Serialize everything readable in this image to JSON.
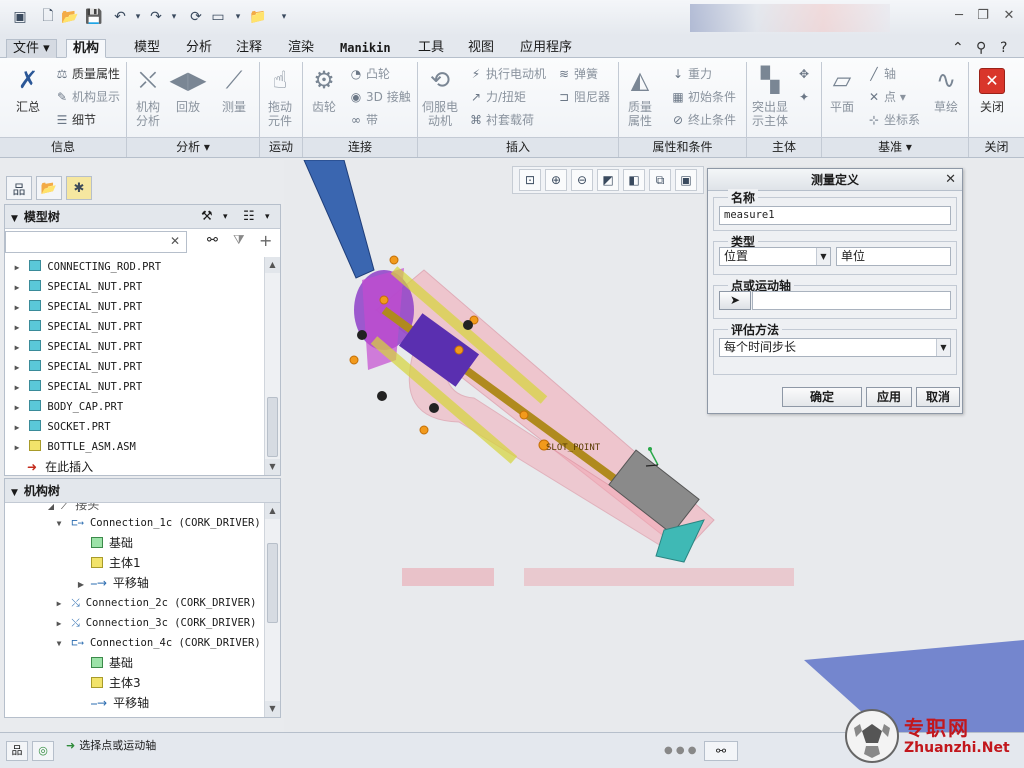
{
  "ribbon": {
    "tabs": [
      {
        "label": "文件 ▾",
        "active": false
      },
      {
        "label": "机构",
        "active": true
      },
      {
        "label": "模型"
      },
      {
        "label": "分析"
      },
      {
        "label": "注释"
      },
      {
        "label": "渲染"
      },
      {
        "label": "Manikin"
      },
      {
        "label": "工具"
      },
      {
        "label": "视图"
      },
      {
        "label": "应用程序"
      }
    ],
    "groups": {
      "info": {
        "label": "信息",
        "summary": "汇总",
        "mass_props": "质量属性",
        "mech_display": "机构显示",
        "detail": "细节"
      },
      "analysis": {
        "label": "分析 ▾",
        "mech_analysis": "机构\n分析",
        "playback": "回放",
        "measure": "测量"
      },
      "motion": {
        "label": "运动",
        "drag": "拖动\n元件"
      },
      "connection": {
        "label": "连接",
        "gear": "齿轮",
        "cam": "凸轮",
        "contact3d": "3D 接触",
        "belt": "带"
      },
      "insert": {
        "label": "插入",
        "servo": "伺服电\n动机",
        "motor": "执行电动机",
        "force": "力/扭矩",
        "bushing": "衬套载荷",
        "spring": "弹簧",
        "damper": "阻尼器"
      },
      "props": {
        "label": "属性和条件",
        "mass": "质量\n属性",
        "gravity": "重力",
        "init": "初始条件",
        "term": "终止条件"
      },
      "body": {
        "label": "主体",
        "highlight": "突出显\n示主体"
      },
      "datum": {
        "label": "基准 ▾",
        "plane": "平面",
        "axis": "轴",
        "point": "点 ▾",
        "csys": "坐标系",
        "sketch": "草绘"
      },
      "close": {
        "label": "关闭",
        "close": "关闭"
      }
    }
  },
  "model_tree": {
    "title": "模型树",
    "search_placeholder": "",
    "items": [
      {
        "label": "CONNECTING_ROD.PRT",
        "type": "part"
      },
      {
        "label": "SPECIAL_NUT.PRT",
        "type": "part"
      },
      {
        "label": "SPECIAL_NUT.PRT",
        "type": "part"
      },
      {
        "label": "SPECIAL_NUT.PRT",
        "type": "part"
      },
      {
        "label": "SPECIAL_NUT.PRT",
        "type": "part"
      },
      {
        "label": "SPECIAL_NUT.PRT",
        "type": "part"
      },
      {
        "label": "SPECIAL_NUT.PRT",
        "type": "part"
      },
      {
        "label": "BODY_CAP.PRT",
        "type": "part"
      },
      {
        "label": "SOCKET.PRT",
        "type": "part"
      },
      {
        "label": "BOTTLE_ASM.ASM",
        "type": "asm"
      }
    ],
    "insert_here": "在此插入"
  },
  "mech_tree": {
    "title": "机构树",
    "rows": [
      {
        "label": "接头",
        "level": 1
      },
      {
        "label": "Connection_1c (CORK_DRIVER)",
        "level": 2
      },
      {
        "label": "基础",
        "level": 3
      },
      {
        "label": "主体1",
        "level": 3
      },
      {
        "label": "平移轴",
        "level": 3
      },
      {
        "label": "Connection_2c (CORK_DRIVER)",
        "level": 2
      },
      {
        "label": "Connection_3c (CORK_DRIVER)",
        "level": 2
      },
      {
        "label": "Connection_4c (CORK_DRIVER)",
        "level": 2
      },
      {
        "label": "基础",
        "level": 3
      },
      {
        "label": "主体3",
        "level": 3
      },
      {
        "label": "平移轴",
        "level": 3
      }
    ]
  },
  "viewport": {
    "annotation": "SLOT_POINT"
  },
  "dialog": {
    "title": "测量定义",
    "name_label": "名称",
    "name_value": "measure1",
    "type_label": "类型",
    "type_value": "位置",
    "unit_value": "单位",
    "point_label": "点或运动轴",
    "eval_label": "评估方法",
    "eval_value": "每个时间步长",
    "ok": "确定",
    "apply": "应用",
    "cancel": "取消"
  },
  "status": {
    "message": "选择点或运动轴"
  },
  "watermark": {
    "text": "专职网",
    "url": "Zhuanzhi.Net"
  },
  "colors": {
    "accent": "#2b5797",
    "close_red": "#d9362b",
    "logo_red": "#c2171d"
  }
}
